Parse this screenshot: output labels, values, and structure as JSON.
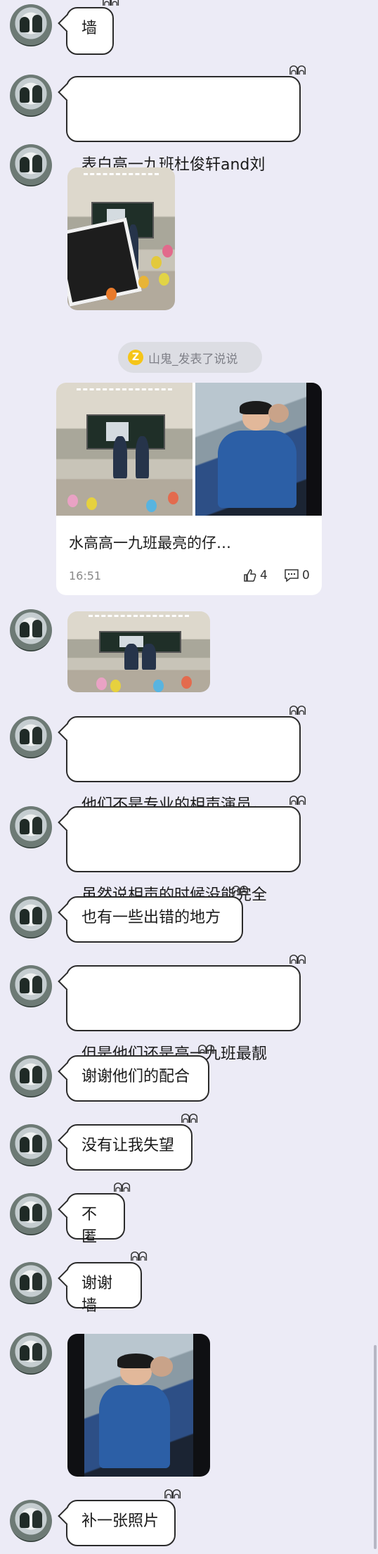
{
  "colors": {
    "background": "#ecebf6",
    "bubble_border": "#2b2b2b",
    "notice_bg": "#dcdde3",
    "notice_icon": "#f5c518"
  },
  "messages": [
    {
      "text": "墙"
    },
    {
      "text": "表白高一九班杜俊轩and刘\n旭"
    },
    {
      "text": "他们不是专业的相声演员，\n没有接受过专业的训练"
    },
    {
      "text": "虽然说相声的时候没能完全\n脱稿"
    },
    {
      "text": "也有一些出错的地方"
    },
    {
      "text": "但是他们还是高一九班最靓\n的仔"
    },
    {
      "text": "谢谢他们的配合"
    },
    {
      "text": "没有让我失望"
    },
    {
      "text": "不匿"
    },
    {
      "text": "谢谢墙"
    },
    {
      "text": "补一张照片"
    }
  ],
  "notice": {
    "icon": "z-icon",
    "text": "山鬼_发表了说说"
  },
  "post_card": {
    "title": "水高高一九班最亮的仔…",
    "time": "16:51",
    "likes": "4",
    "comments": "0"
  }
}
